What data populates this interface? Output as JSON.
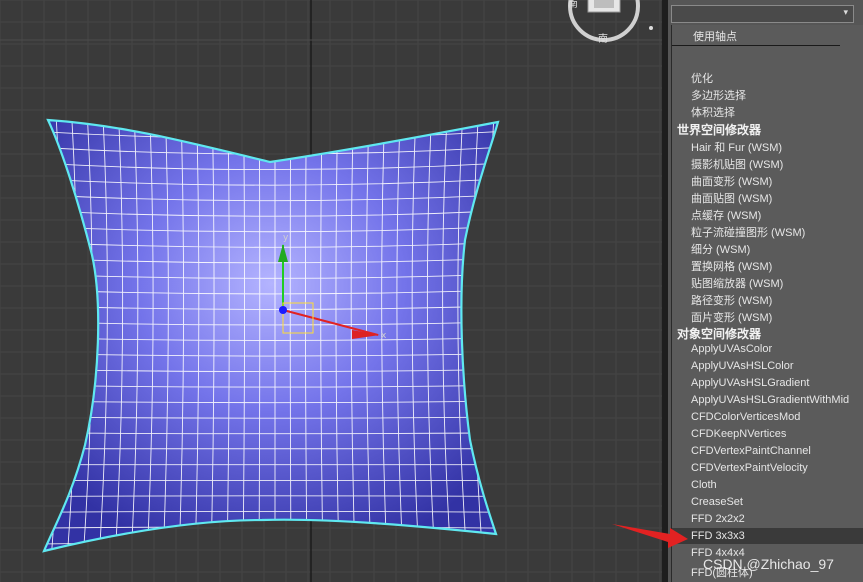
{
  "viewcube": {
    "top_label": "南",
    "bottom_label": "南"
  },
  "axis": {
    "x_label": "x",
    "y_label": "y"
  },
  "dropdown": {
    "arrow": "▾"
  },
  "modifier_list": {
    "top_item": "使用轴点",
    "items_group_top": [
      "优化",
      "多边形选择",
      "体积选择"
    ],
    "world_header": "世界空间修改器",
    "world_items": [
      "Hair 和 Fur (WSM)",
      "摄影机贴图 (WSM)",
      "曲面变形 (WSM)",
      "曲面贴图 (WSM)",
      "点缓存 (WSM)",
      "粒子流碰撞图形 (WSM)",
      "细分 (WSM)",
      "置换网格 (WSM)",
      "贴图缩放器 (WSM)",
      "路径变形 (WSM)",
      "面片变形 (WSM)"
    ],
    "object_header": "对象空间修改器",
    "object_items": [
      "ApplyUVAsColor",
      "ApplyUVAsHSLColor",
      "ApplyUVAsHSLGradient",
      "ApplyUVAsHSLGradientWithMid",
      "CFDColorVerticesMod",
      "CFDKeepNVertices",
      "CFDVertexPaintChannel",
      "CFDVertexPaintVelocity",
      "Cloth",
      "CreaseSet",
      "FFD 2x2x2",
      "FFD 3x3x3",
      "FFD 4x4x4",
      "FFD(圆柱体)"
    ],
    "selected_item": "FFD 3x3x3"
  },
  "watermark": "CSDN @Zhichao_97",
  "colors": {
    "pillow": "#7f7ff0",
    "outline": "#5fe8f0",
    "accent_red": "#e22222"
  }
}
